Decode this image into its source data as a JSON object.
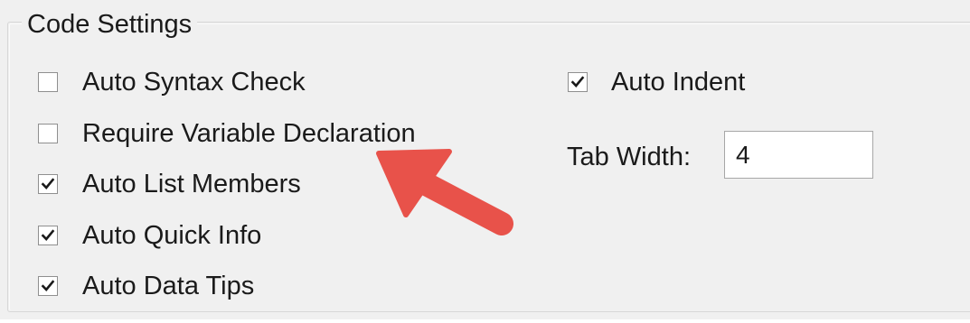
{
  "group": {
    "title": "Code Settings"
  },
  "options": {
    "auto_syntax_check": {
      "label": "Auto Syntax Check",
      "checked": false
    },
    "require_variable_declaration": {
      "label": "Require Variable Declaration",
      "checked": false
    },
    "auto_list_members": {
      "label": "Auto List Members",
      "checked": true
    },
    "auto_quick_info": {
      "label": "Auto Quick Info",
      "checked": true
    },
    "auto_data_tips": {
      "label": "Auto Data Tips",
      "checked": true
    },
    "auto_indent": {
      "label": "Auto Indent",
      "checked": true
    }
  },
  "tab_width": {
    "label": "Tab Width:",
    "value": "4"
  },
  "annotation": {
    "arrow_color": "#e8524a",
    "icon": "arrow-pointer-icon"
  },
  "colors": {
    "background": "#f0f0f0",
    "checkbox_border": "#8f8f8f",
    "check_mark": "#1a1a1a"
  }
}
